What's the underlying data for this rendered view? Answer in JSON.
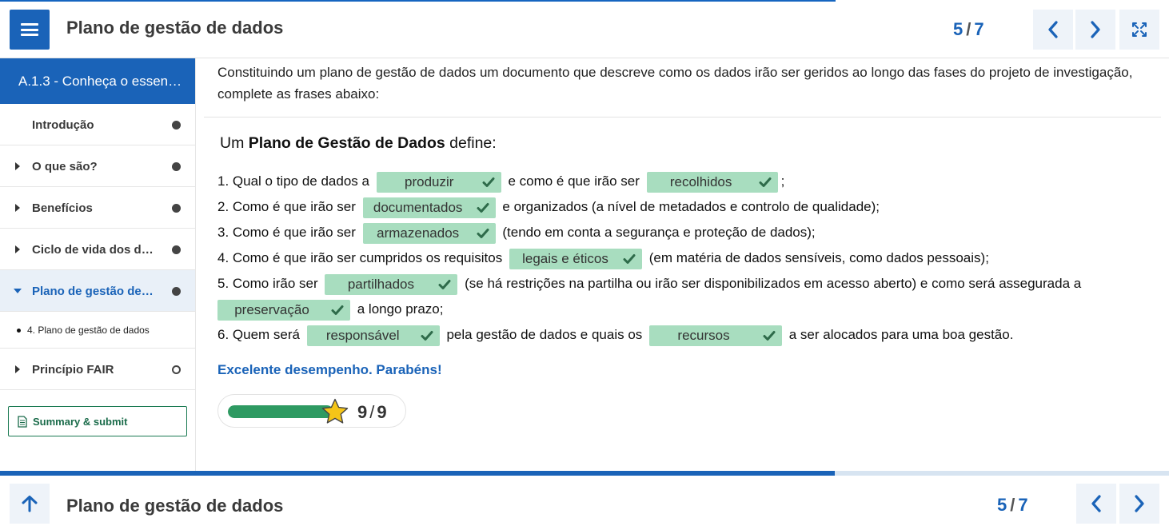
{
  "header": {
    "title": "Plano de gestão de dados",
    "page_current": "5",
    "page_total": "7",
    "progress_fraction": 0.714
  },
  "sidebar": {
    "heading": "A.1.3 - Conheça o essen…",
    "items": [
      {
        "label": "Introdução",
        "status": "complete"
      },
      {
        "label": "O que são?",
        "status": "complete"
      },
      {
        "label": "Benefícios",
        "status": "complete"
      },
      {
        "label": "Ciclo de vida dos d…",
        "status": "complete"
      },
      {
        "label": "Plano de gestão de…",
        "status": "complete",
        "active": true
      },
      {
        "label": "Princípio FAIR",
        "status": "incomplete"
      }
    ],
    "sub_item": "4. Plano de gestão de dados",
    "summary_button": "Summary & submit"
  },
  "content": {
    "intro": "Constituindo um plano de gestão de dados um documento que descreve como os dados irão ser geridos ao longo das fases do projeto de investigação, complete as frases abaixo:",
    "question_prefix": "Um ",
    "question_bold": "Plano de Gestão de Dados",
    "question_suffix": " define:",
    "line1": {
      "a": "1. Qual o tipo de dados a",
      "chip1": "produzir",
      "b": "e como é que irão ser",
      "chip2": "recolhidos",
      "c": ";"
    },
    "line2": {
      "a": "2. Como é que irão ser",
      "chip1": "documentados",
      "b": "e organizados (a nível de metadados e controlo de qualidade);"
    },
    "line3": {
      "a": "3. Como é que irão ser",
      "chip1": "armazenados",
      "b": "(tendo em conta a segurança e proteção de dados);"
    },
    "line4": {
      "a": "4. Como é que irão ser cumpridos os requisitos",
      "chip1": "legais e éticos",
      "b": "(em matéria de dados sensíveis, como dados pessoais);"
    },
    "line5": {
      "a": "5. Como irão ser",
      "chip1": "partilhados",
      "b": "(se há restrições na partilha ou irão ser disponibilizados em acesso aberto) e como será assegurada a",
      "chip2": "preservação",
      "c": "a longo prazo;"
    },
    "line6": {
      "a": "6. Quem será",
      "chip1": "responsável",
      "b": "pela gestão de dados e quais os",
      "chip2": "recursos",
      "c": "a ser alocados para uma boa gestão."
    },
    "feedback": "Excelente desempenho. Parabéns!",
    "score": {
      "value": "9",
      "total": "9",
      "fraction": 1.0
    }
  },
  "footer": {
    "title": "Plano de gestão de dados",
    "page_current": "5",
    "page_total": "7",
    "progress_fraction": 0.714
  },
  "colors": {
    "accent": "#1a63b8",
    "chip": "#a8ddbf",
    "check": "#2e6b4a",
    "score_fill": "#2e9a62",
    "star": "#f5c518"
  },
  "icons": [
    "menu-icon",
    "chevron-left-icon",
    "chevron-right-icon",
    "fullscreen-icon",
    "check-icon",
    "star-icon",
    "document-icon",
    "arrow-up-icon"
  ]
}
